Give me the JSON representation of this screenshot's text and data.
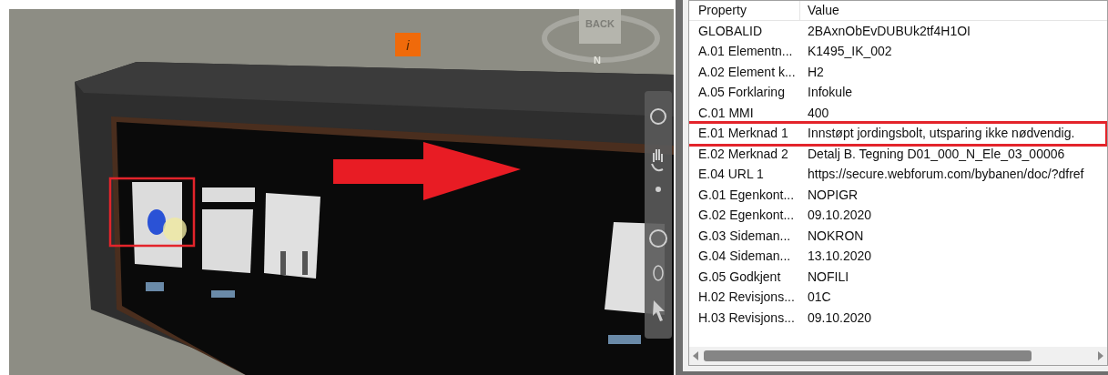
{
  "viewport": {
    "view_cube_label": "BACK",
    "compass_label": "N",
    "info_marker": "i"
  },
  "properties": {
    "columns": [
      "Property",
      "Value"
    ],
    "rows": [
      {
        "property": "GLOBALID",
        "value": "2BAxnObEvDUBUk2tf4H1OI",
        "highlighted": false
      },
      {
        "property": "A.01 Elementn...",
        "value": "K1495_IK_002",
        "highlighted": false
      },
      {
        "property": "A.02 Element k...",
        "value": "H2",
        "highlighted": false
      },
      {
        "property": "A.05 Forklaring",
        "value": "Infokule",
        "highlighted": false
      },
      {
        "property": "C.01 MMI",
        "value": "400",
        "highlighted": false
      },
      {
        "property": "E.01 Merknad 1",
        "value": "Innstøpt jordingsbolt, utsparing ikke nødvendig.",
        "highlighted": true
      },
      {
        "property": "E.02 Merknad 2",
        "value": "Detalj B. Tegning D01_000_N_Ele_03_00006",
        "highlighted": false
      },
      {
        "property": "E.04 URL 1",
        "value": "https://secure.webforum.com/bybanen/doc/?dfref",
        "highlighted": false
      },
      {
        "property": "G.01 Egenkont...",
        "value": "NOPIGR",
        "highlighted": false
      },
      {
        "property": "G.02 Egenkont...",
        "value": "09.10.2020",
        "highlighted": false
      },
      {
        "property": "G.03 Sideman...",
        "value": "NOKRON",
        "highlighted": false
      },
      {
        "property": "G.04 Sideman...",
        "value": "13.10.2020",
        "highlighted": false
      },
      {
        "property": "G.05 Godkjent",
        "value": "NOFILI",
        "highlighted": false
      },
      {
        "property": "H.02 Revisjons...",
        "value": "01C",
        "highlighted": false
      },
      {
        "property": "H.03 Revisjons...",
        "value": "09.10.2020",
        "highlighted": false
      }
    ]
  }
}
